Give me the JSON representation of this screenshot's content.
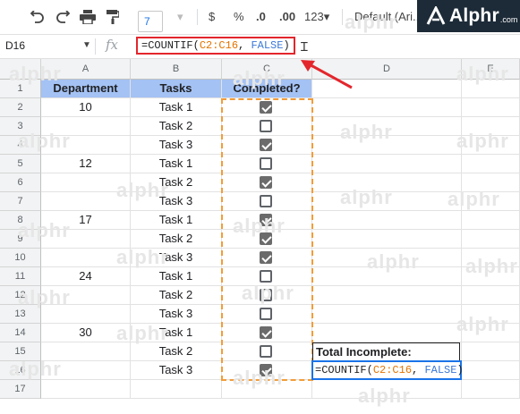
{
  "toolbar": {
    "zoom_value": "7",
    "currency_label": "$",
    "percent_label": "%",
    "decrease_decimal_label": ".0",
    "increase_decimal_label": ".00",
    "format_label": "123",
    "font_label": "Default (Ari..."
  },
  "logo": {
    "word": "Alphr",
    "suffix": ".com"
  },
  "formula_bar": {
    "cell_ref": "D16",
    "fx": "fx",
    "formula_prefix": "=COUNTIF(",
    "formula_range": "C2:C16",
    "formula_sep": ", ",
    "formula_arg": "FALSE",
    "formula_suffix": ")"
  },
  "columns": [
    "A",
    "B",
    "C",
    "D",
    "E"
  ],
  "rows": [
    "1",
    "2",
    "3",
    "4",
    "5",
    "6",
    "7",
    "8",
    "9",
    "10",
    "11",
    "12",
    "13",
    "14",
    "15",
    "16",
    "17"
  ],
  "headers": {
    "department": "Department",
    "tasks": "Tasks",
    "completed": "Completed?"
  },
  "data_rows": [
    {
      "dept": "10",
      "task": "Task 1",
      "done": true
    },
    {
      "dept": "",
      "task": "Task 2",
      "done": false
    },
    {
      "dept": "",
      "task": "Task 3",
      "done": true
    },
    {
      "dept": "12",
      "task": "Task 1",
      "done": false
    },
    {
      "dept": "",
      "task": "Task 2",
      "done": true
    },
    {
      "dept": "",
      "task": "Task 3",
      "done": false
    },
    {
      "dept": "17",
      "task": "Task 1",
      "done": true
    },
    {
      "dept": "",
      "task": "Task 2",
      "done": true
    },
    {
      "dept": "",
      "task": "Task 3",
      "done": true
    },
    {
      "dept": "24",
      "task": "Task 1",
      "done": false
    },
    {
      "dept": "",
      "task": "Task 2",
      "done": false
    },
    {
      "dept": "",
      "task": "Task 3",
      "done": false
    },
    {
      "dept": "30",
      "task": "Task 1",
      "done": true
    },
    {
      "dept": "",
      "task": "Task 2",
      "done": false
    },
    {
      "dept": "",
      "task": "Task 3",
      "done": true
    }
  ],
  "total_incomplete": {
    "label": "Total Incomplete:",
    "formula_prefix": "=COUNTIF(",
    "formula_range": "C2:C16",
    "formula_sep": ", ",
    "formula_arg": "FALSE",
    "formula_suffix": ")"
  },
  "watermark": "alphr",
  "colors": {
    "header_fill": "#a4c2f4",
    "highlight_red": "#e3262c",
    "dash_orange": "#f29c38",
    "selection_blue": "#1a73e8"
  }
}
